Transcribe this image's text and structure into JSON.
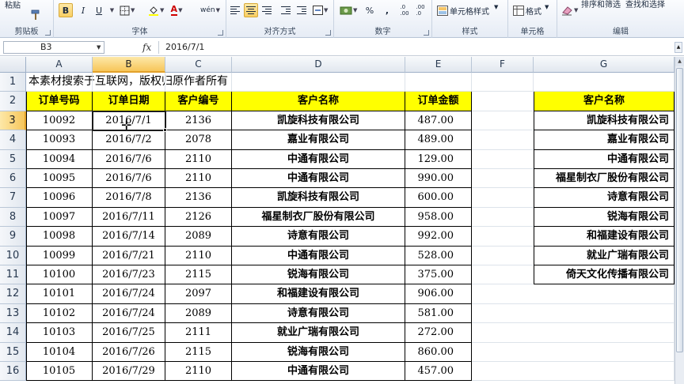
{
  "ribbon": {
    "groups": {
      "clipboard": "剪贴板",
      "font": "字体",
      "alignment": "对齐方式",
      "number": "数字",
      "styles": "样式",
      "cells": "单元格",
      "editing": "编辑"
    },
    "paste_label": "粘贴",
    "bold_label": "B",
    "italic_label": "I",
    "underline_label": "U",
    "font_color_label": "A",
    "phonetic_label": "wén",
    "percent_label": "%",
    "comma_label": ",",
    "cell_styles_label": "单元格样式",
    "format_label": "格式",
    "sort_filter_label": "排序和筛选",
    "find_select_label": "查找和选择",
    "accent_color": "#f9cf63"
  },
  "formula_bar": {
    "name_box": "B3",
    "fx_label": "fx",
    "content": "2016/7/1"
  },
  "sheet": {
    "columns": [
      "A",
      "B",
      "C",
      "D",
      "E",
      "F",
      "G"
    ],
    "rows": [
      "1",
      "2",
      "3",
      "4",
      "5",
      "6",
      "7",
      "8",
      "9",
      "10",
      "11",
      "12",
      "13",
      "14",
      "15",
      "16"
    ],
    "row1_text": "本素材搜索于互联网，版权归原作者所有",
    "headers": [
      "订单号码",
      "订单日期",
      "客户编号",
      "客户名称",
      "订单金额"
    ],
    "side_header": "客户名称",
    "orders": [
      [
        "10092",
        "2016/7/1",
        "2136",
        "凯旋科技有限公司",
        "487.00"
      ],
      [
        "10093",
        "2016/7/2",
        "2078",
        "嘉业有限公司",
        "489.00"
      ],
      [
        "10094",
        "2016/7/6",
        "2110",
        "中通有限公司",
        "129.00"
      ],
      [
        "10095",
        "2016/7/6",
        "2110",
        "中通有限公司",
        "990.00"
      ],
      [
        "10096",
        "2016/7/8",
        "2136",
        "凯旋科技有限公司",
        "600.00"
      ],
      [
        "10097",
        "2016/7/11",
        "2126",
        "福星制衣厂股份有限公司",
        "958.00"
      ],
      [
        "10098",
        "2016/7/14",
        "2089",
        "诗意有限公司",
        "992.00"
      ],
      [
        "10099",
        "2016/7/21",
        "2110",
        "中通有限公司",
        "528.00"
      ],
      [
        "10100",
        "2016/7/23",
        "2115",
        "锐海有限公司",
        "375.00"
      ],
      [
        "10101",
        "2016/7/24",
        "2097",
        "和福建设有限公司",
        "906.00"
      ],
      [
        "10102",
        "2016/7/24",
        "2089",
        "诗意有限公司",
        "581.00"
      ],
      [
        "10103",
        "2016/7/25",
        "2111",
        "就业广瑞有限公司",
        "272.00"
      ],
      [
        "10104",
        "2016/7/26",
        "2115",
        "锐海有限公司",
        "860.00"
      ],
      [
        "10105",
        "2016/7/29",
        "2110",
        "中通有限公司",
        "457.00"
      ]
    ],
    "customers": [
      "凯旋科技有限公司",
      "嘉业有限公司",
      "中通有限公司",
      "福星制衣厂股份有限公司",
      "诗意有限公司",
      "锐海有限公司",
      "和福建设有限公司",
      "就业广瑞有限公司",
      "倚天文化传播有限公司"
    ],
    "header_fill_color": "#ffff00",
    "selected_cell": "B3"
  }
}
